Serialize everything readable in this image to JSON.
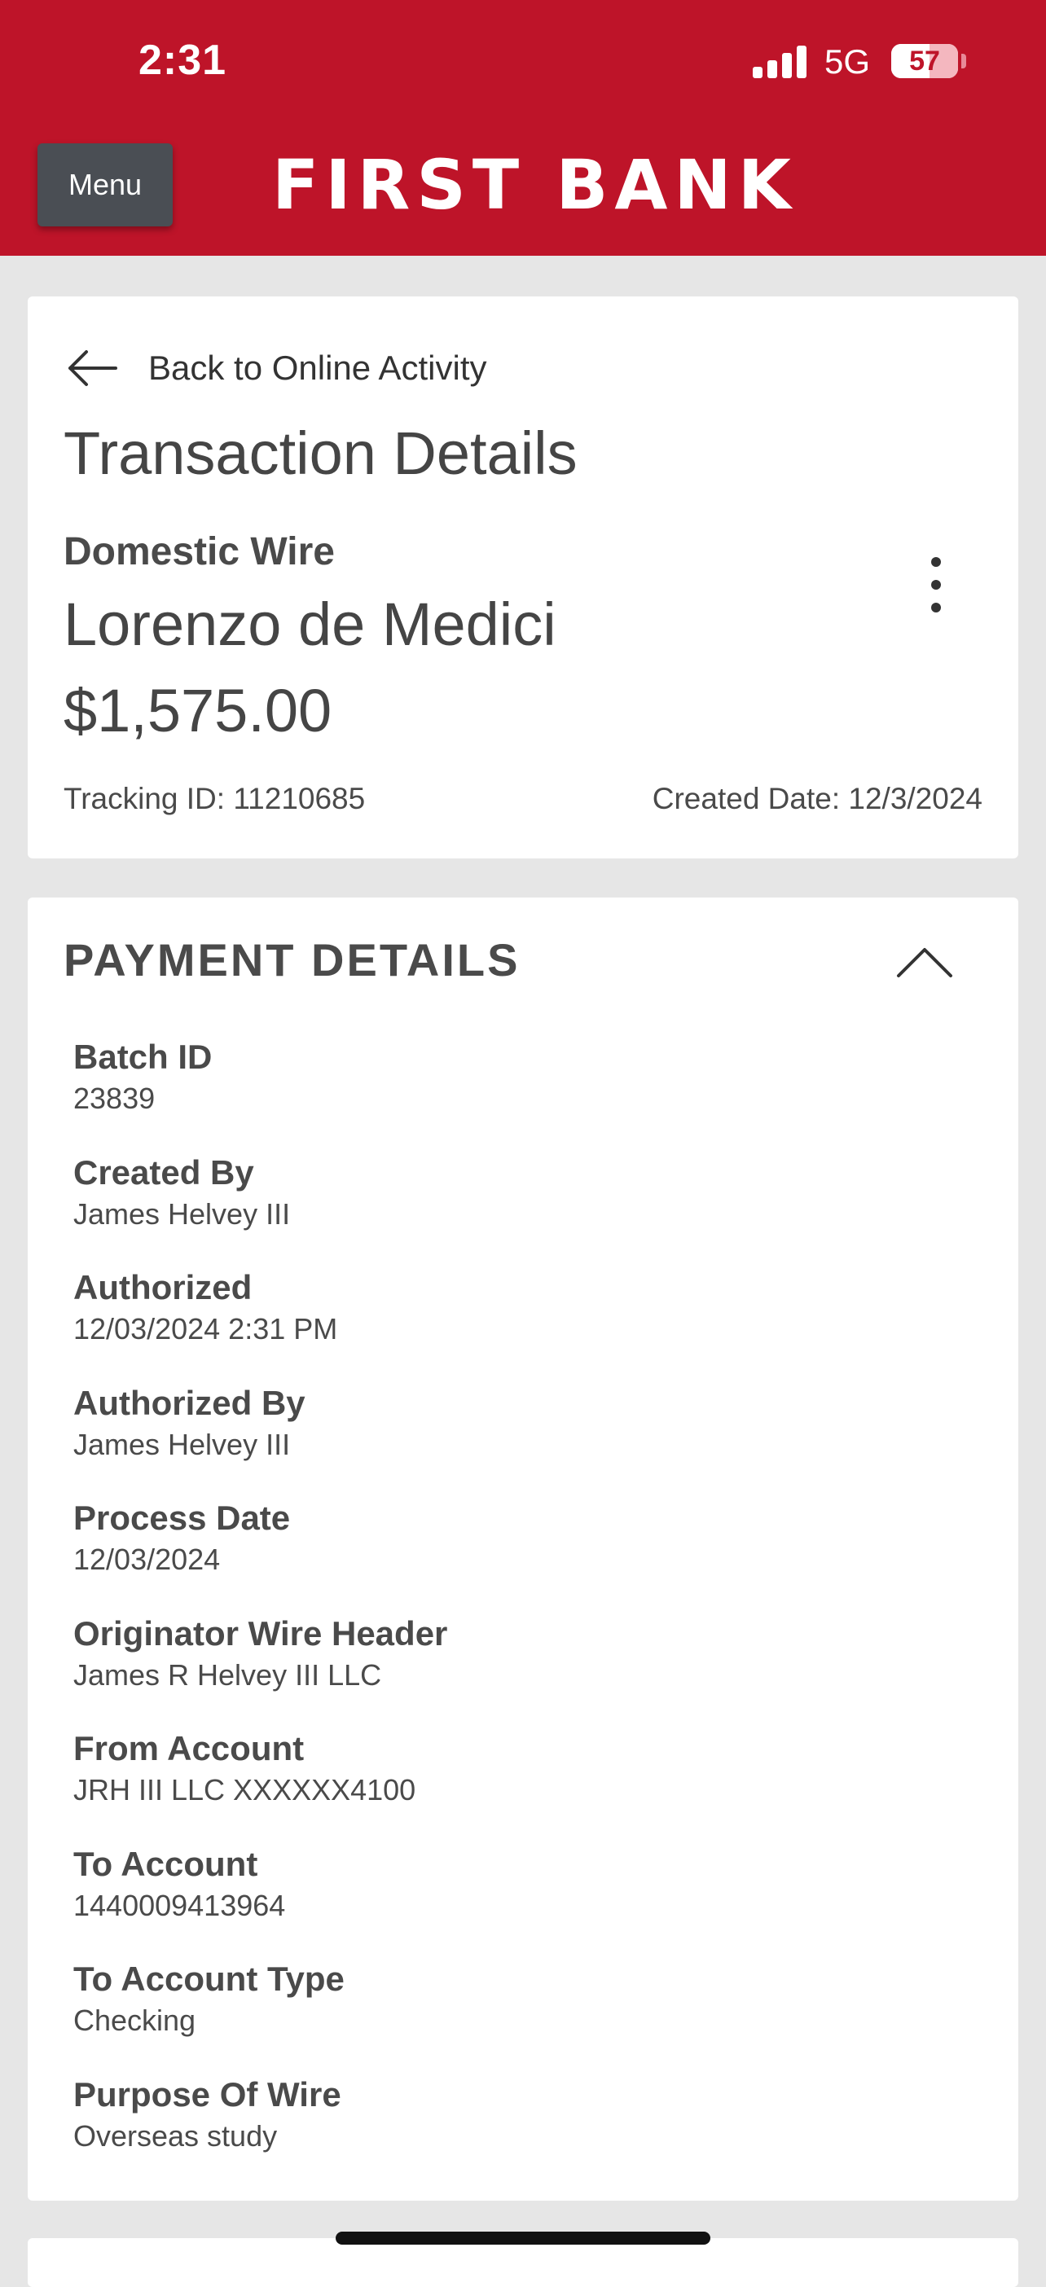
{
  "status_bar": {
    "time": "2:31",
    "network": "5G",
    "battery": "57"
  },
  "header": {
    "menu_label": "Menu",
    "brand": "FIRST BANK"
  },
  "transaction": {
    "back_label": "Back to Online Activity",
    "title": "Transaction Details",
    "wire_type": "Domestic Wire",
    "payee": "Lorenzo de Medici",
    "amount": "$1,575.00",
    "tracking": "Tracking ID: 11210685",
    "created_date": "Created Date: 12/3/2024"
  },
  "payment_details": {
    "section_title": "PAYMENT DETAILS",
    "fields": [
      {
        "label": "Batch ID",
        "value": "23839"
      },
      {
        "label": "Created By",
        "value": "James Helvey III"
      },
      {
        "label": "Authorized",
        "value": "12/03/2024 2:31 PM"
      },
      {
        "label": "Authorized By",
        "value": "James Helvey III"
      },
      {
        "label": "Process Date",
        "value": "12/03/2024"
      },
      {
        "label": "Originator Wire Header",
        "value": "James R Helvey III LLC"
      },
      {
        "label": "From Account",
        "value": "JRH III LLC XXXXXX4100"
      },
      {
        "label": "To Account",
        "value": "1440009413964"
      },
      {
        "label": "To Account Type",
        "value": "Checking"
      },
      {
        "label": "Purpose Of Wire",
        "value": "Overseas study"
      }
    ]
  },
  "colors": {
    "brand_red": "#be1429",
    "menu_button": "#4a4e54",
    "background": "#e6e6e6"
  },
  "icons": [
    "back-arrow-icon",
    "more-vertical-icon",
    "chevron-up-icon",
    "signal-icon",
    "battery-icon"
  ]
}
